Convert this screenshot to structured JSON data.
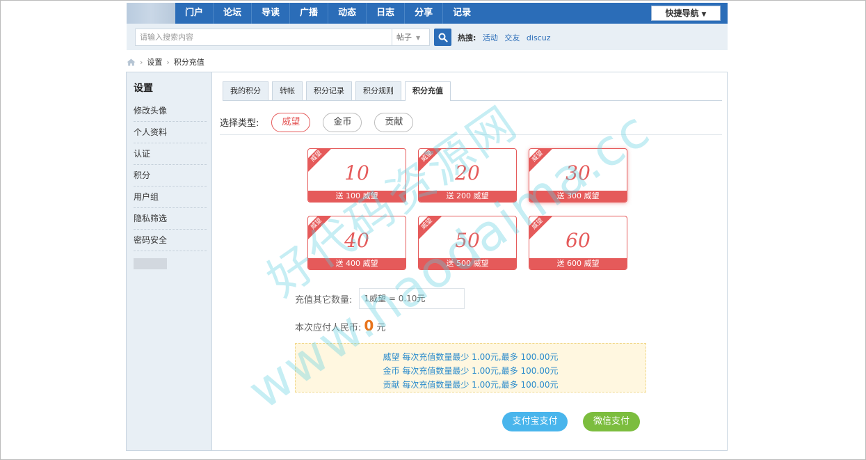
{
  "nav": {
    "items": [
      "门户",
      "论坛",
      "导读",
      "广播",
      "动态",
      "日志",
      "分享",
      "记录"
    ],
    "quick_nav": "快捷导航"
  },
  "search": {
    "placeholder": "请输入搜索内容",
    "type": "帖子",
    "hot_label": "热搜:",
    "hot_keywords": [
      "活动",
      "交友",
      "discuz"
    ]
  },
  "breadcrumb": [
    "设置",
    "积分充值"
  ],
  "sidebar": {
    "title": "设置",
    "items": [
      "修改头像",
      "个人资料",
      "认证",
      "积分",
      "用户组",
      "隐私筛选",
      "密码安全"
    ]
  },
  "tabs": [
    "我的积分",
    "转帐",
    "积分记录",
    "积分规则",
    "积分充值"
  ],
  "recharge": {
    "type_label": "选择类型:",
    "types": [
      "威望",
      "金币",
      "贡献"
    ],
    "cards": [
      {
        "corner": "威望",
        "amount": "10",
        "bonus": "送 100 威望"
      },
      {
        "corner": "威望",
        "amount": "20",
        "bonus": "送 200 威望"
      },
      {
        "corner": "威望",
        "amount": "30",
        "bonus": "送 300 威望"
      },
      {
        "corner": "威望",
        "amount": "40",
        "bonus": "送 400 威望"
      },
      {
        "corner": "威望",
        "amount": "50",
        "bonus": "送 500 威望"
      },
      {
        "corner": "威望",
        "amount": "60",
        "bonus": "送 600 威望"
      }
    ],
    "other_label": "充值其它数量:",
    "other_placeholder": "1威望 = 0.10元",
    "pay_label": "本次应付人民币:",
    "pay_amount": "0",
    "pay_unit": "元",
    "notices": [
      "威望 每次充值数量最少 1.00元,最多 100.00元",
      "金币 每次充值数量最少 1.00元,最多 100.00元",
      "贡献 每次充值数量最少 1.00元,最多 100.00元"
    ],
    "alipay_label": "支付宝支付",
    "wechat_label": "微信支付"
  },
  "watermark": {
    "line1": "好代码资源网",
    "line2": "www.haodaima.cc"
  },
  "colors": {
    "nav_blue": "#2b6db8",
    "accent_red": "#e55a5a",
    "alipay_blue": "#49b5ec",
    "wechat_green": "#7cbd3e",
    "pay_orange": "#e8741c"
  }
}
